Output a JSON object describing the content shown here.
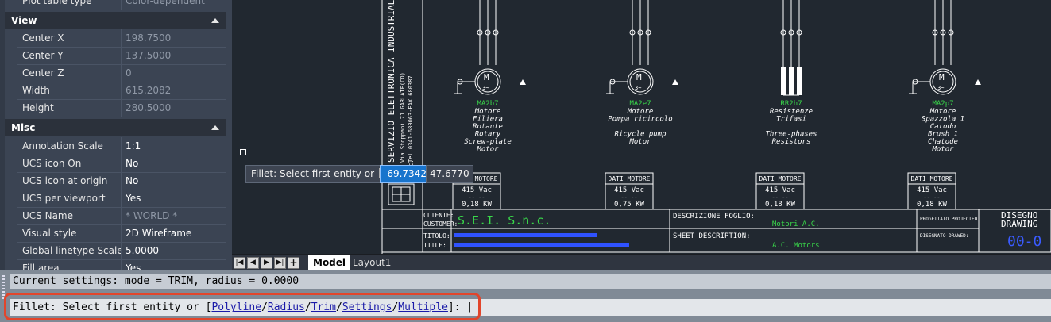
{
  "properties": {
    "top_row": {
      "label": "Plot table type",
      "value": "Color-dependent plo..."
    },
    "sections": [
      {
        "title": "View",
        "rows": [
          {
            "label": "Center X",
            "value": "198.7500"
          },
          {
            "label": "Center Y",
            "value": "137.5000"
          },
          {
            "label": "Center Z",
            "value": "0"
          },
          {
            "label": "Width",
            "value": "615.2082"
          },
          {
            "label": "Height",
            "value": "280.5000"
          }
        ]
      },
      {
        "title": "Misc",
        "rows": [
          {
            "label": "Annotation Scale",
            "value": "1:1"
          },
          {
            "label": "UCS icon On",
            "value": "No"
          },
          {
            "label": "UCS icon at origin",
            "value": "No"
          },
          {
            "label": "UCS per viewport",
            "value": "Yes"
          },
          {
            "label": "UCS Name",
            "value": "* WORLD *"
          },
          {
            "label": "Visual style",
            "value": "2D Wireframe"
          },
          {
            "label": "Global linetype Scale",
            "value": "5.0000"
          },
          {
            "label": "Fill area",
            "value": "Yes"
          }
        ]
      }
    ]
  },
  "drawing": {
    "company_vertical": [
      "SERVIZIO ELETTRONICA INDUSTRIALE",
      "Via Stoppani,71 GARLATE(CO)",
      "Tel.0341-680063-FAX 680387",
      "C."
    ],
    "motors": [
      {
        "id": "MA2b7",
        "desc": [
          "Motore",
          "Filiera",
          "Rotante",
          "Rotary",
          "Screw-plate",
          "Motor"
        ],
        "data_title": "DATI MOTORE",
        "voltage": "415 Vac",
        "dashes": "-- --",
        "power": "0,18 KW"
      },
      {
        "id": "MA2e7",
        "desc": [
          "Motore",
          "Pompa ricircolo",
          "",
          "Ricycle pump",
          "Motor"
        ],
        "data_title": "DATI MOTORE",
        "voltage": "415 Vac",
        "dashes": "-- --",
        "power": "0,75 KW"
      },
      {
        "id": "RR2h7",
        "desc": [
          "Resistenze",
          "Trifasi",
          "",
          "Three-phases",
          "Resistors"
        ],
        "data_title": "DATI MOTORE",
        "voltage": "415 Vac",
        "dashes": "-- --",
        "power": "0,18 KW"
      },
      {
        "id": "MA2p7",
        "desc": [
          "Motore",
          "Spazzola 1",
          "Catodo",
          "Brush 1",
          "Chatode",
          "Motor"
        ],
        "data_title": "DATI MOTORE",
        "voltage": "415 Vac",
        "dashes": "-- --",
        "power": "0,18 KW"
      }
    ],
    "titleblock": {
      "cliente": "CLIENTE:",
      "customer": "CUSTOMER:",
      "customer_value": "S.E.I. S.n.c.",
      "titolo": "TITOLO:",
      "title": "TITLE:",
      "descrizione": "DESCRIZIONE FOGLIO:",
      "descrizione_value": "Motori A.C.",
      "sheet_desc": "SHEET DESCRIPTION:",
      "sheet_desc_value": "A.C. Motors",
      "progettato": "PROGETTATO PROJECTED:",
      "disegnato": "DISEGNATO DRAWED:",
      "disegno": "DISEGNO",
      "drawing": "DRAWING",
      "drawing_no": "00-0"
    }
  },
  "input_tooltip": {
    "prompt": "Fillet: Select first entity or",
    "x": "-69.7342",
    "y": "47.6770"
  },
  "layout_tabs": {
    "model": "Model",
    "layout1": "Layout1"
  },
  "command": {
    "history": "Current settings: mode = TRIM, radius = 0.0000",
    "prompt_prefix": "Fillet: Select first entity or [",
    "options": [
      "Polyline",
      "Radius",
      "Trim",
      "Settings",
      "Multiple"
    ],
    "prompt_suffix": "]:"
  },
  "colors": {
    "accent": "#1874cd",
    "highlight": "#e2452b",
    "cad_green": "#39d84a",
    "cad_blue": "#4a7bff"
  }
}
